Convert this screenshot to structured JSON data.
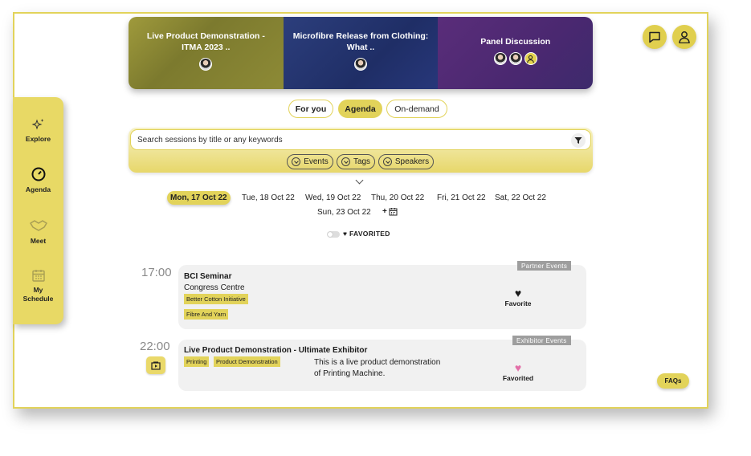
{
  "featured": [
    {
      "title": "Live Product Demonstration - ITMA 2023 ..",
      "speakers": [
        "speaker-photo"
      ]
    },
    {
      "title": "Microfibre Release from Clothing: What ..",
      "speakers": [
        "speaker-photo"
      ]
    },
    {
      "title": "Panel Discussion",
      "speakers": [
        "speaker-photo",
        "speaker-photo",
        "user-icon"
      ]
    }
  ],
  "header": {
    "chat_icon": "chat-bubble-icon",
    "profile_icon": "user-icon"
  },
  "sidebar": {
    "items": [
      {
        "label": "Explore",
        "icon": "sparkles-icon"
      },
      {
        "label": "Agenda",
        "icon": "clock-icon"
      },
      {
        "label": "Meet",
        "icon": "handshake-icon"
      },
      {
        "label": "My Schedule",
        "icon": "calendar-icon"
      }
    ]
  },
  "tabs": [
    {
      "label": "For you"
    },
    {
      "label": "Agenda",
      "active": true
    },
    {
      "label": "On-demand"
    }
  ],
  "search": {
    "placeholder": "Search sessions by title or any keywords"
  },
  "filters": [
    {
      "label": "Events"
    },
    {
      "label": "Tags"
    },
    {
      "label": "Speakers"
    }
  ],
  "dates": [
    {
      "label": "Mon, 17 Oct 22",
      "active": true
    },
    {
      "label": "Tue, 18 Oct 22"
    },
    {
      "label": "Wed, 19 Oct 22"
    },
    {
      "label": "Thu, 20 Oct 22"
    },
    {
      "label": "Fri, 21 Oct 22"
    },
    {
      "label": "Sat, 22 Oct 22"
    },
    {
      "label": "Sun, 23 Oct 22"
    }
  ],
  "add_date": "+",
  "favorited_toggle": {
    "label": "♥ FAVORITED",
    "on": false
  },
  "sessions": [
    {
      "time": "17:00",
      "category": "Partner Events",
      "title": "BCI Seminar",
      "location": "Congress Centre",
      "tags": [
        "Better Cotton Initiative",
        "Fibre And Yarn"
      ],
      "description": "",
      "favorite_label": "Favorite",
      "favorited": false
    },
    {
      "time": "22:00",
      "category": "Exhibitor Events",
      "title": "Live Product Demonstration - Ultimate Exhibitor",
      "location": "",
      "tags": [
        "Printing",
        "Product Demonstration"
      ],
      "description_line1": "This is a live product demonstration",
      "description_line2": "of Printing Machine.",
      "favorite_label": "Favorited",
      "favorited": true
    }
  ],
  "faq_label": "FAQs",
  "colors": {
    "accent": "#e2d35a",
    "heart_on": "#e36fa8",
    "heart_off": "#1a1a1a",
    "card_bg": "#f1f1f1"
  }
}
